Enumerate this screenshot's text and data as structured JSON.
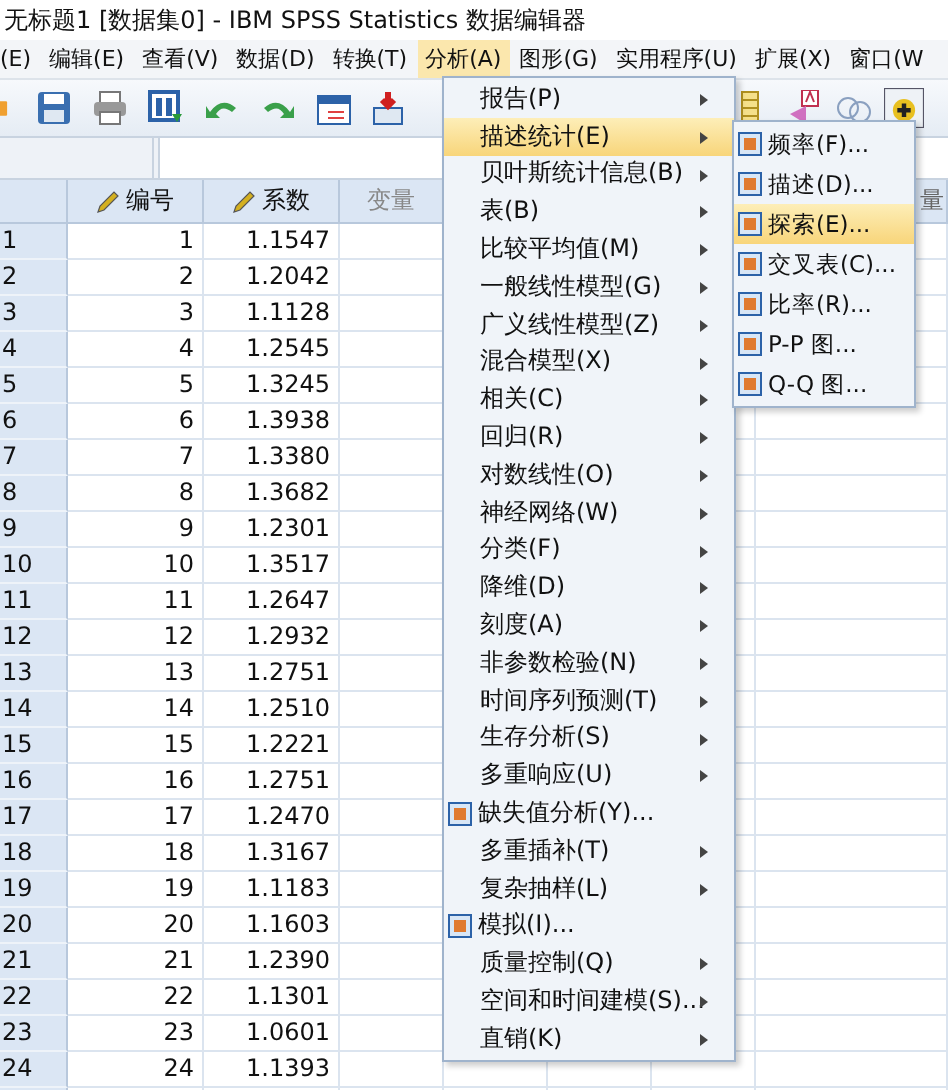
{
  "window": {
    "title": "无标题1 [数据集0] - IBM SPSS Statistics 数据编辑器"
  },
  "menu_bar": [
    {
      "label": "(E)",
      "selected": false
    },
    {
      "label": "编辑(E)",
      "selected": false
    },
    {
      "label": "查看(V)",
      "selected": false
    },
    {
      "label": "数据(D)",
      "selected": false
    },
    {
      "label": "转换(T)",
      "selected": false
    },
    {
      "label": "分析(A)",
      "selected": true
    },
    {
      "label": "图形(G)",
      "selected": false
    },
    {
      "label": "实用程序(U)",
      "selected": false
    },
    {
      "label": "扩展(X)",
      "selected": false
    },
    {
      "label": "窗口(W",
      "selected": false
    }
  ],
  "grid": {
    "columns": [
      {
        "label": "编号",
        "kind": "variable"
      },
      {
        "label": "系数",
        "kind": "variable"
      },
      {
        "label": "变量",
        "kind": "empty"
      },
      {
        "kind": "empty"
      },
      {
        "kind": "empty"
      },
      {
        "kind": "empty"
      },
      {
        "label": "量",
        "kind": "empty"
      }
    ],
    "rows": [
      {
        "row": "1",
        "cells": [
          "1",
          "1.1547"
        ]
      },
      {
        "row": "2",
        "cells": [
          "2",
          "1.2042"
        ]
      },
      {
        "row": "3",
        "cells": [
          "3",
          "1.1128"
        ]
      },
      {
        "row": "4",
        "cells": [
          "4",
          "1.2545"
        ]
      },
      {
        "row": "5",
        "cells": [
          "5",
          "1.3245"
        ]
      },
      {
        "row": "6",
        "cells": [
          "6",
          "1.3938"
        ]
      },
      {
        "row": "7",
        "cells": [
          "7",
          "1.3380"
        ]
      },
      {
        "row": "8",
        "cells": [
          "8",
          "1.3682"
        ]
      },
      {
        "row": "9",
        "cells": [
          "9",
          "1.2301"
        ]
      },
      {
        "row": "10",
        "cells": [
          "10",
          "1.3517"
        ]
      },
      {
        "row": "11",
        "cells": [
          "11",
          "1.2647"
        ]
      },
      {
        "row": "12",
        "cells": [
          "12",
          "1.2932"
        ]
      },
      {
        "row": "13",
        "cells": [
          "13",
          "1.2751"
        ]
      },
      {
        "row": "14",
        "cells": [
          "14",
          "1.2510"
        ]
      },
      {
        "row": "15",
        "cells": [
          "15",
          "1.2221"
        ]
      },
      {
        "row": "16",
        "cells": [
          "16",
          "1.2751"
        ]
      },
      {
        "row": "17",
        "cells": [
          "17",
          "1.2470"
        ]
      },
      {
        "row": "18",
        "cells": [
          "18",
          "1.3167"
        ]
      },
      {
        "row": "19",
        "cells": [
          "19",
          "1.1183"
        ]
      },
      {
        "row": "20",
        "cells": [
          "20",
          "1.1603"
        ]
      },
      {
        "row": "21",
        "cells": [
          "21",
          "1.2390"
        ]
      },
      {
        "row": "22",
        "cells": [
          "22",
          "1.1301"
        ]
      },
      {
        "row": "23",
        "cells": [
          "23",
          "1.0601"
        ]
      },
      {
        "row": "24",
        "cells": [
          "24",
          "1.1393"
        ]
      }
    ]
  },
  "analyze_menu": [
    {
      "label": "报告(P)",
      "kind": "submenu",
      "selected": false
    },
    {
      "label": "描述统计(E)",
      "kind": "submenu",
      "selected": true
    },
    {
      "label": "贝叶斯统计信息(B)",
      "kind": "submenu",
      "selected": false
    },
    {
      "label": "表(B)",
      "kind": "submenu",
      "selected": false
    },
    {
      "label": "比较平均值(M)",
      "kind": "submenu",
      "selected": false
    },
    {
      "label": "一般线性模型(G)",
      "kind": "submenu",
      "selected": false
    },
    {
      "label": "广义线性模型(Z)",
      "kind": "submenu",
      "selected": false
    },
    {
      "label": "混合模型(X)",
      "kind": "submenu",
      "selected": false
    },
    {
      "label": "相关(C)",
      "kind": "submenu",
      "selected": false
    },
    {
      "label": "回归(R)",
      "kind": "submenu",
      "selected": false
    },
    {
      "label": "对数线性(O)",
      "kind": "submenu",
      "selected": false
    },
    {
      "label": "神经网络(W)",
      "kind": "submenu",
      "selected": false
    },
    {
      "label": "分类(F)",
      "kind": "submenu",
      "selected": false
    },
    {
      "label": "降维(D)",
      "kind": "submenu",
      "selected": false
    },
    {
      "label": "刻度(A)",
      "kind": "submenu",
      "selected": false
    },
    {
      "label": "非参数检验(N)",
      "kind": "submenu",
      "selected": false
    },
    {
      "label": "时间序列预测(T)",
      "kind": "submenu",
      "selected": false
    },
    {
      "label": "生存分析(S)",
      "kind": "submenu",
      "selected": false
    },
    {
      "label": "多重响应(U)",
      "kind": "submenu",
      "selected": false
    },
    {
      "label": "缺失值分析(Y)...",
      "kind": "action",
      "selected": false
    },
    {
      "label": "多重插补(T)",
      "kind": "submenu",
      "selected": false
    },
    {
      "label": "复杂抽样(L)",
      "kind": "submenu",
      "selected": false
    },
    {
      "label": "模拟(I)...",
      "kind": "action",
      "selected": false
    },
    {
      "label": "质量控制(Q)",
      "kind": "submenu",
      "selected": false
    },
    {
      "label": "空间和时间建模(S)...",
      "kind": "submenu",
      "selected": false
    },
    {
      "label": "直销(K)",
      "kind": "submenu",
      "selected": false
    }
  ],
  "descriptives_submenu": [
    {
      "label": "频率(F)...",
      "selected": false
    },
    {
      "label": "描述(D)...",
      "selected": false
    },
    {
      "label": "探索(E)...",
      "selected": true
    },
    {
      "label": "交叉表(C)...",
      "selected": false
    },
    {
      "label": "比率(R)...",
      "selected": false
    },
    {
      "label": "P-P 图...",
      "selected": false
    },
    {
      "label": "Q-Q 图...",
      "selected": false
    }
  ]
}
